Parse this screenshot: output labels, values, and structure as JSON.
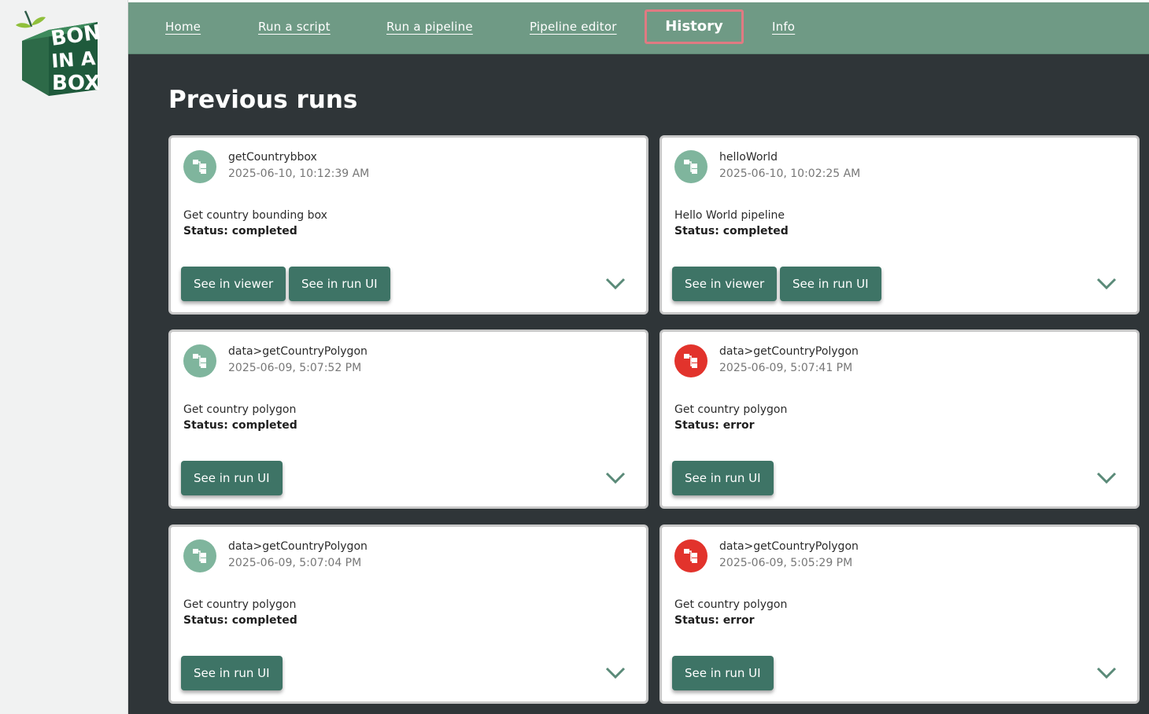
{
  "nav": {
    "home": "Home",
    "run_script": "Run a script",
    "run_pipeline": "Run a pipeline",
    "pipeline_editor": "Pipeline editor",
    "history": "History",
    "info": "Info"
  },
  "logo": {
    "text_line1": "BON",
    "text_line2": "IN A",
    "text_line3": "BOX"
  },
  "page": {
    "title": "Previous runs"
  },
  "colors": {
    "ok_icon": "#7fb59d",
    "error_icon": "#e2332c",
    "button": "#3e7466",
    "nav_bg": "#6f9a85",
    "main_bg": "#2f3538"
  },
  "runs": [
    {
      "name": "getCountrybbox",
      "time": "2025-06-10, 10:12:39 AM",
      "description": "Get country bounding box",
      "status_label": "Status: completed",
      "icon": "pipeline-icon",
      "state": "ok",
      "btn_viewer": "See in viewer",
      "btn_run_ui": "See in run UI"
    },
    {
      "name": "helloWorld",
      "time": "2025-06-10, 10:02:25 AM",
      "description": "Hello World pipeline",
      "status_label": "Status: completed",
      "icon": "pipeline-icon",
      "state": "ok",
      "btn_viewer": "See in viewer",
      "btn_run_ui": "See in run UI"
    },
    {
      "name": "data>getCountryPolygon",
      "time": "2025-06-09, 5:07:52 PM",
      "description": "Get country polygon",
      "status_label": "Status: completed",
      "icon": "pipeline-icon",
      "state": "ok",
      "btn_run_ui": "See in run UI"
    },
    {
      "name": "data>getCountryPolygon",
      "time": "2025-06-09, 5:07:41 PM",
      "description": "Get country polygon",
      "status_label": "Status: error",
      "icon": "pipeline-icon",
      "state": "error",
      "btn_run_ui": "See in run UI"
    },
    {
      "name": "data>getCountryPolygon",
      "time": "2025-06-09, 5:07:04 PM",
      "description": "Get country polygon",
      "status_label": "Status: completed",
      "icon": "pipeline-icon",
      "state": "ok",
      "btn_run_ui": "See in run UI"
    },
    {
      "name": "data>getCountryPolygon",
      "time": "2025-06-09, 5:05:29 PM",
      "description": "Get country polygon",
      "status_label": "Status: error",
      "icon": "pipeline-icon",
      "state": "error",
      "btn_run_ui": "See in run UI"
    }
  ]
}
